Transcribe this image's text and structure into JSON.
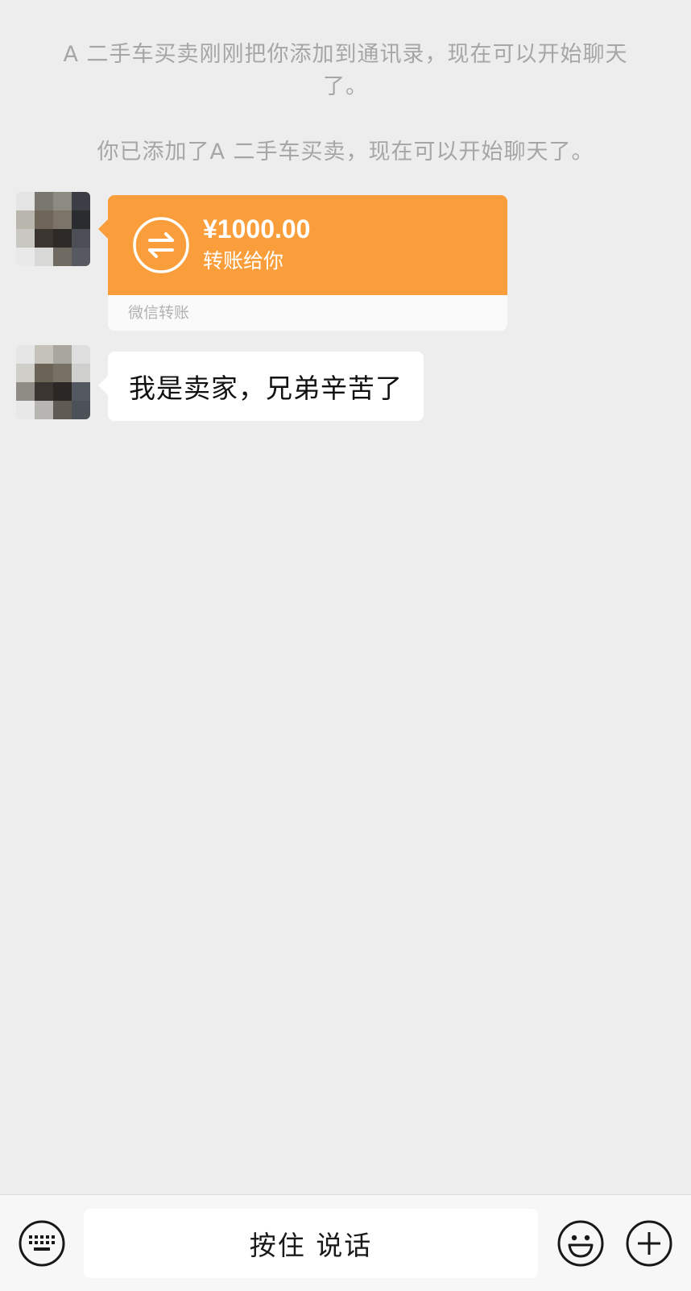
{
  "system_notes": {
    "added_by_contact": "A 二手车买卖刚刚把你添加到通讯录，现在可以开始聊天了。",
    "you_added_contact": "你已添加了A 二手车买卖，现在可以开始聊天了。"
  },
  "messages": [
    {
      "type": "transfer",
      "amount": "¥1000.00",
      "description": "转账给你",
      "source": "微信转账",
      "icon": "transfer-arrows-icon",
      "accent_color": "#fa9e3b"
    },
    {
      "type": "text",
      "text": "我是卖家，兄弟辛苦了"
    }
  ],
  "input_bar": {
    "voice_label": "按住 说话",
    "left_icon": "keyboard-icon",
    "emoji_icon": "emoji-icon",
    "plus_icon": "plus-icon"
  },
  "colors": {
    "background": "#ededed",
    "transfer_card": "#fa9e3b",
    "bubble": "#ffffff"
  }
}
